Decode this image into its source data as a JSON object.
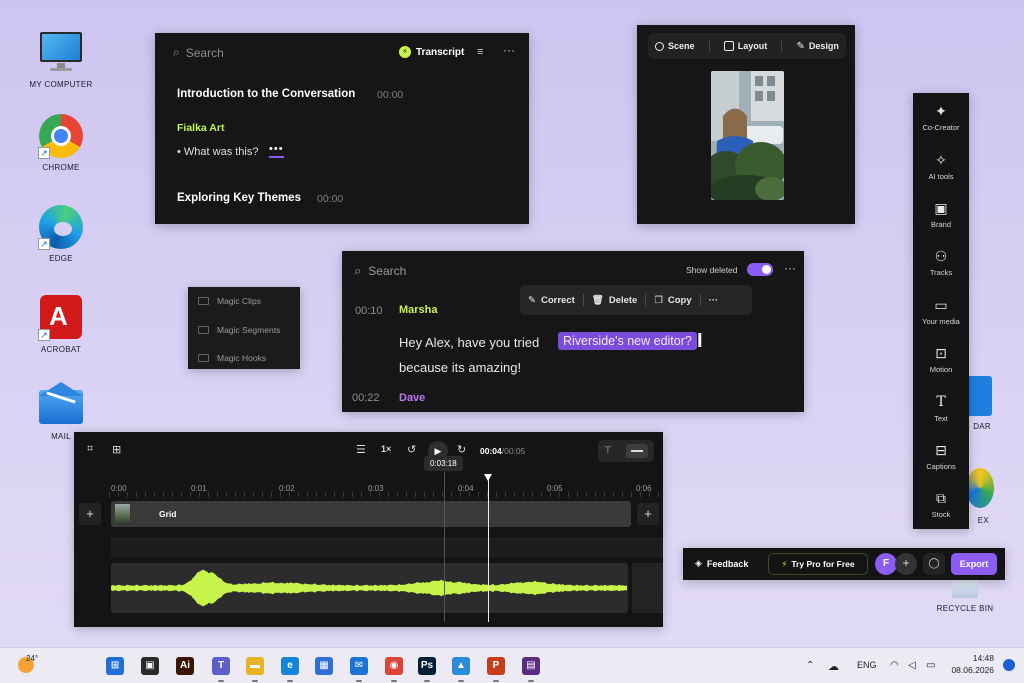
{
  "desktop": {
    "icons": [
      {
        "label": "MY COMPUTER"
      },
      {
        "label": "CHROME"
      },
      {
        "label": "EDGE"
      },
      {
        "label": "ACROBAT"
      },
      {
        "label": "MAIL"
      },
      {
        "label": "DAR"
      },
      {
        "label": "EX"
      },
      {
        "label": "RECYCLE BIN"
      }
    ]
  },
  "transcript_panel": {
    "search_placeholder": "Search",
    "transcript_label": "Transcript",
    "section1_title": "Introduction to the Conversation",
    "section1_time": "00:00",
    "speaker": "Fialka Art",
    "line_text": "• What was this?",
    "ellipsis": "•••",
    "section2_title": "Exploring Key Themes",
    "section2_time": "00:00"
  },
  "scene_panel": {
    "tabs": [
      {
        "label": "Scene",
        "icon": "circle-icon"
      },
      {
        "label": "Layout",
        "icon": "layout-icon"
      },
      {
        "label": "Design",
        "icon": "brush-icon"
      }
    ]
  },
  "magic_menu": {
    "items": [
      {
        "label": "Magic Clips"
      },
      {
        "label": "Magic Segments"
      },
      {
        "label": "Magic Hooks"
      }
    ]
  },
  "editor_panel": {
    "search_placeholder": "Search",
    "show_deleted_label": "Show deleted",
    "context_menu": {
      "correct": "Correct",
      "delete": "Delete",
      "copy": "Copy"
    },
    "entries": [
      {
        "time": "00:10",
        "speaker": "Marsha"
      },
      {
        "time": "00:22",
        "speaker": "Dave"
      }
    ],
    "sentence_before": "Hey Alex, have you tried",
    "highlighted": "Riverside's new editor?",
    "sentence_after": "because its amazing!"
  },
  "timeline": {
    "speed": "1×",
    "current_time": "00:04",
    "total_time": "/00:05",
    "tooltip": "0:03:18",
    "ticks": [
      "0:00",
      "0:01",
      "0:02",
      "0:03",
      "0:04",
      "0:05",
      "0:06"
    ],
    "clip_label": "Grid",
    "add_label": "+"
  },
  "right_toolbar": {
    "items": [
      {
        "label": "Co-Creator",
        "icon": "sparkle-icon"
      },
      {
        "label": "AI tools",
        "icon": "ai-tools-icon"
      },
      {
        "label": "Brand",
        "icon": "brand-icon"
      },
      {
        "label": "Tracks",
        "icon": "tracks-icon"
      },
      {
        "label": "Your media",
        "icon": "folder-icon"
      },
      {
        "label": "Motion",
        "icon": "motion-icon"
      },
      {
        "label": "Text",
        "icon": "text-icon"
      },
      {
        "label": "Captions",
        "icon": "captions-icon"
      },
      {
        "label": "Stock",
        "icon": "stock-icon"
      }
    ]
  },
  "bottom_bar": {
    "feedback": "Feedback",
    "try_pro": "Try Pro for Free",
    "avatar_initial": "F",
    "export": "Export"
  },
  "taskbar": {
    "weather": "24°",
    "language": "ENG",
    "time": "14:48",
    "date": "08.06.2026",
    "apps": [
      {
        "name": "start-icon",
        "glyph": "⊞",
        "color": "#1f6fd6"
      },
      {
        "name": "task-view-icon",
        "glyph": "▣",
        "color": "#2a2a2a"
      },
      {
        "name": "illustrator-icon",
        "glyph": "Ai",
        "color": "#3a1400"
      },
      {
        "name": "teams-icon",
        "glyph": "T",
        "color": "#5b5fc7"
      },
      {
        "name": "file-explorer-icon",
        "glyph": "▬",
        "color": "#e8b324"
      },
      {
        "name": "edge-taskbar-icon",
        "glyph": "e",
        "color": "#1684d9"
      },
      {
        "name": "store-icon",
        "glyph": "▦",
        "color": "#2f6fd6"
      },
      {
        "name": "mail-taskbar-icon",
        "glyph": "✉",
        "color": "#1a74d6"
      },
      {
        "name": "chrome-taskbar-icon",
        "glyph": "◉",
        "color": "#db4437"
      },
      {
        "name": "photoshop-icon",
        "glyph": "Ps",
        "color": "#001e36"
      },
      {
        "name": "photos-icon",
        "glyph": "▲",
        "color": "#2d8cd8"
      },
      {
        "name": "powerpoint-icon",
        "glyph": "P",
        "color": "#c43e1c"
      },
      {
        "name": "media-icon",
        "glyph": "▤",
        "color": "#5a2d82"
      }
    ]
  }
}
